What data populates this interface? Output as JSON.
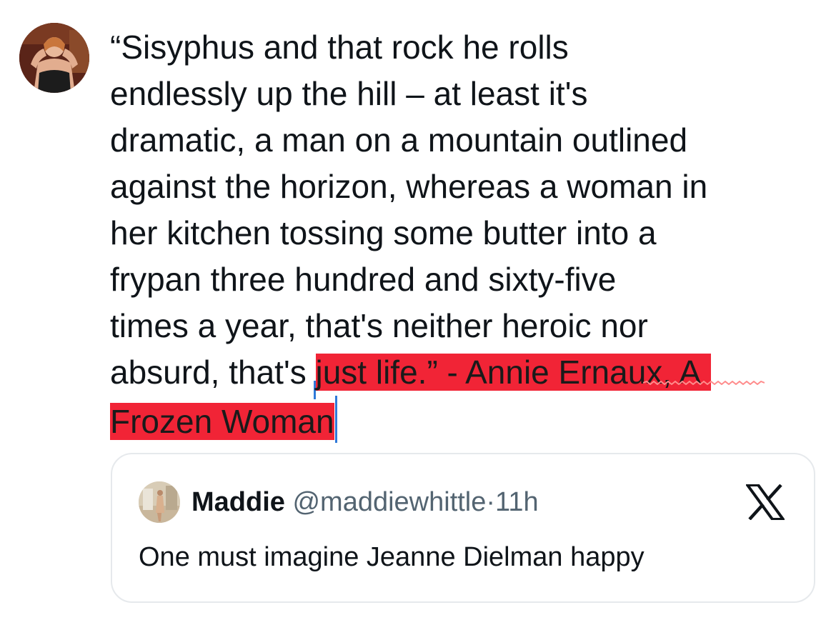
{
  "tweet": {
    "lines": [
      "“Sisyphus and that rock he rolls",
      "endlessly up the hill – at least it's",
      "dramatic, a man on a mountain outlined",
      "against the horizon, whereas a woman in",
      "her kitchen tossing some butter into a",
      "frypan three hundred and sixty-five",
      "times a year, that's neither heroic nor"
    ],
    "line8_plain": "absurd, that's ",
    "line8_highlight": "just life.” - Annie Ernaux, A",
    "line9_highlight": "Frozen Woman",
    "highlight_color": "#f12436",
    "caret_color": "#2f7ad9"
  },
  "quoted_tweet": {
    "display_name": "Maddie",
    "handle": "@maddiewhittle",
    "separator": "·",
    "time": "11h",
    "text": "One must imagine Jeanne Dielman happy",
    "platform_icon": "x-logo-icon"
  },
  "avatar_icon": "profile-photo-avatar",
  "quoted_avatar_icon": "profile-photo-avatar"
}
